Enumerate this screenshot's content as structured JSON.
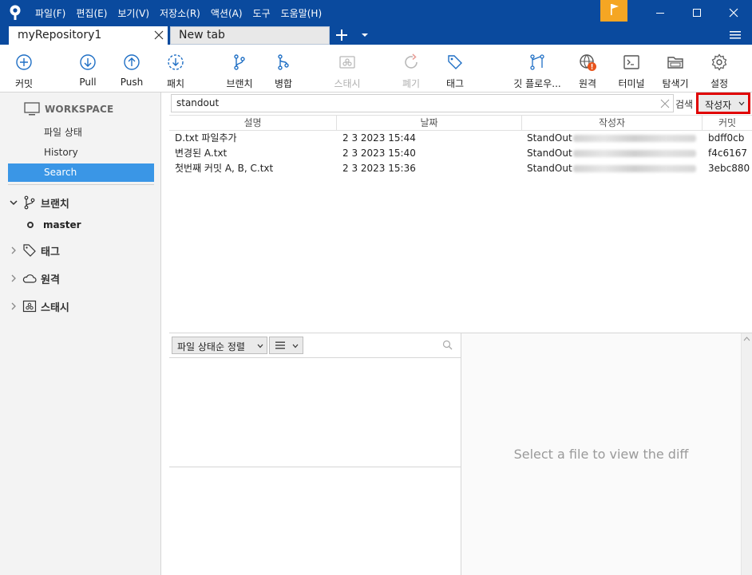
{
  "menubar": {
    "items": [
      "파일(F)",
      "편집(E)",
      "보기(V)",
      "저장소(R)",
      "액션(A)",
      "도구",
      "도움말(H)"
    ]
  },
  "tabs": {
    "active": "myRepository1",
    "new_tab": "New tab"
  },
  "toolbar": {
    "commit": "커밋",
    "pull": "Pull",
    "push": "Push",
    "fetch": "패치",
    "branch": "브랜치",
    "merge": "병합",
    "stash": "스태시",
    "discard": "폐기",
    "tag": "태그",
    "gitflow": "깃 플로우...",
    "remote": "원격",
    "terminal": "터미널",
    "explorer": "탐색기",
    "settings": "설정"
  },
  "sidebar": {
    "workspace": "WORKSPACE",
    "items": [
      "파일 상태",
      "History",
      "Search"
    ],
    "selected": "Search",
    "groups": {
      "branches": "브랜치",
      "tags": "태그",
      "remotes": "원격",
      "stashes": "스태시"
    },
    "branch_current": "master"
  },
  "search": {
    "query": "standout",
    "label": "검색",
    "mode": "작성자"
  },
  "grid": {
    "columns": [
      "설명",
      "날짜",
      "작성자",
      "커밋"
    ],
    "rows": [
      {
        "desc": "D.txt 파일추가",
        "date": "2 3 2023 15:44",
        "author": "StandOut",
        "commit": "bdff0cb"
      },
      {
        "desc": "변경된 A.txt",
        "date": "2 3 2023 15:40",
        "author": "StandOut",
        "commit": "f4c6167"
      },
      {
        "desc": "첫번째 커밋 A, B, C.txt",
        "date": "2 3 2023 15:36",
        "author": "StandOut",
        "commit": "3ebc880"
      }
    ]
  },
  "files": {
    "sort": "파일 상태순 정렬"
  },
  "diff": {
    "placeholder": "Select a file to view the diff"
  },
  "colors": {
    "titlebar": "#0a4a9e",
    "accent": "#3a96e6",
    "flag": "#f5a623",
    "highlight": "#e00000",
    "remote_badge": "#e8541c"
  }
}
